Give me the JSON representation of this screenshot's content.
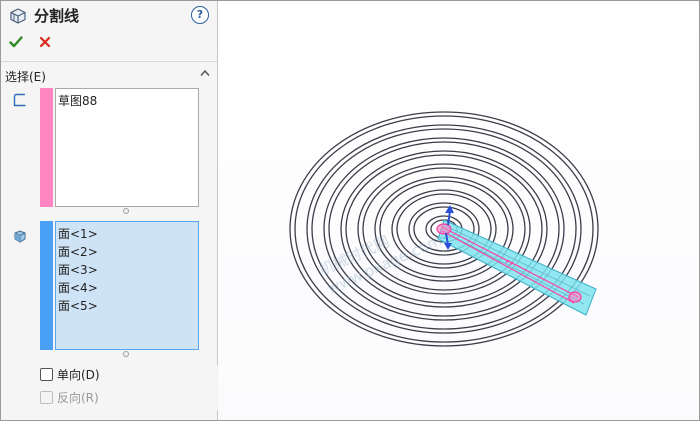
{
  "panel": {
    "title": "分割线",
    "help_label": "?",
    "icons": {
      "feature": "split-line-feature-icon",
      "help": "help-icon",
      "ok": "check-icon",
      "cancel": "close-icon",
      "collapse": "chevron-up-icon"
    },
    "colors": {
      "ok": "#2e8b22",
      "cancel": "#d92a1c",
      "sketch_bar": "#ff85c0",
      "face_bar": "#49a0f4",
      "face_list_bg": "#cfe3f7"
    },
    "selection": {
      "label": "选择(E)",
      "sketch_list": [
        "草图88"
      ],
      "face_list": [
        "面<1>",
        "面<2>",
        "面<3>",
        "面<4>",
        "面<5>"
      ]
    },
    "options": {
      "single_direction": {
        "label": "单向(D)",
        "checked": false,
        "enabled": true
      },
      "reverse": {
        "label": "反向(R)",
        "checked": false,
        "enabled": false
      }
    }
  },
  "viewport": {
    "watermark": [
      "机械时代网",
      "www.pxage.com"
    ],
    "highlight_color": "#7fe3ee",
    "sketch_color": "#ff3fa0"
  }
}
